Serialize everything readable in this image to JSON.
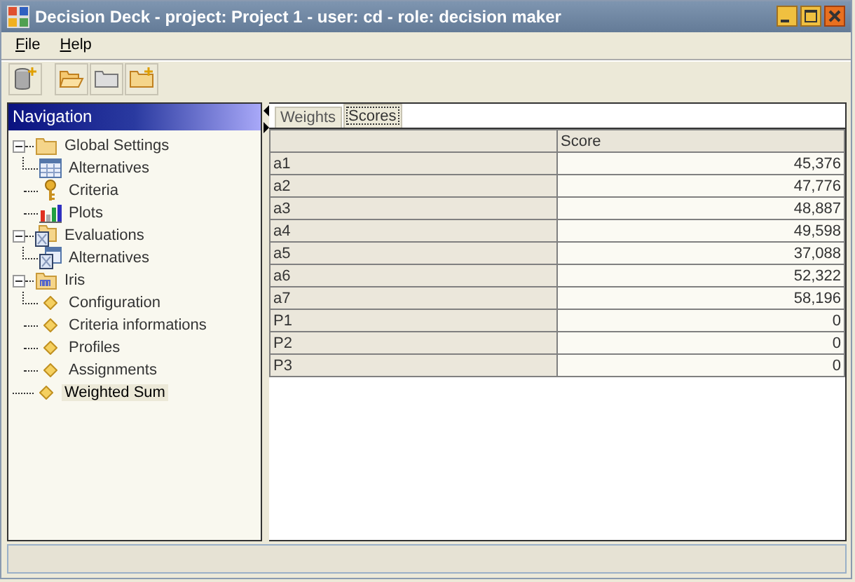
{
  "window": {
    "title": "Decision Deck - project: Project 1 - user: cd - role: decision maker"
  },
  "menu": [
    {
      "label": "File"
    },
    {
      "label": "Help"
    }
  ],
  "navigation": {
    "title": "Navigation",
    "items": [
      {
        "label": "Global Settings",
        "expanded": true,
        "selected": false,
        "children": [
          {
            "label": "Alternatives",
            "selected": false
          },
          {
            "label": "Criteria",
            "selected": false
          },
          {
            "label": "Plots",
            "selected": false
          }
        ]
      },
      {
        "label": "Evaluations",
        "expanded": true,
        "selected": false,
        "children": [
          {
            "label": "Alternatives",
            "selected": false
          }
        ]
      },
      {
        "label": "Iris",
        "expanded": true,
        "selected": false,
        "children": [
          {
            "label": "Configuration",
            "selected": false
          },
          {
            "label": "Criteria informations",
            "selected": false
          },
          {
            "label": "Profiles",
            "selected": false
          },
          {
            "label": "Assignments",
            "selected": false
          }
        ]
      },
      {
        "label": "Weighted Sum",
        "selected": true
      }
    ]
  },
  "tabs": [
    {
      "label": "Weights",
      "selected": false
    },
    {
      "label": "Scores",
      "selected": true
    }
  ],
  "table": {
    "columns": [
      "Score"
    ],
    "rows": [
      {
        "name": "a1",
        "score": "45,376"
      },
      {
        "name": "a2",
        "score": "47,776"
      },
      {
        "name": "a3",
        "score": "48,887"
      },
      {
        "name": "a4",
        "score": "49,598"
      },
      {
        "name": "a5",
        "score": "37,088"
      },
      {
        "name": "a6",
        "score": "52,322"
      },
      {
        "name": "a7",
        "score": "58,196"
      },
      {
        "name": "P1",
        "score": "0"
      },
      {
        "name": "P2",
        "score": "0"
      },
      {
        "name": "P3",
        "score": "0"
      }
    ]
  }
}
